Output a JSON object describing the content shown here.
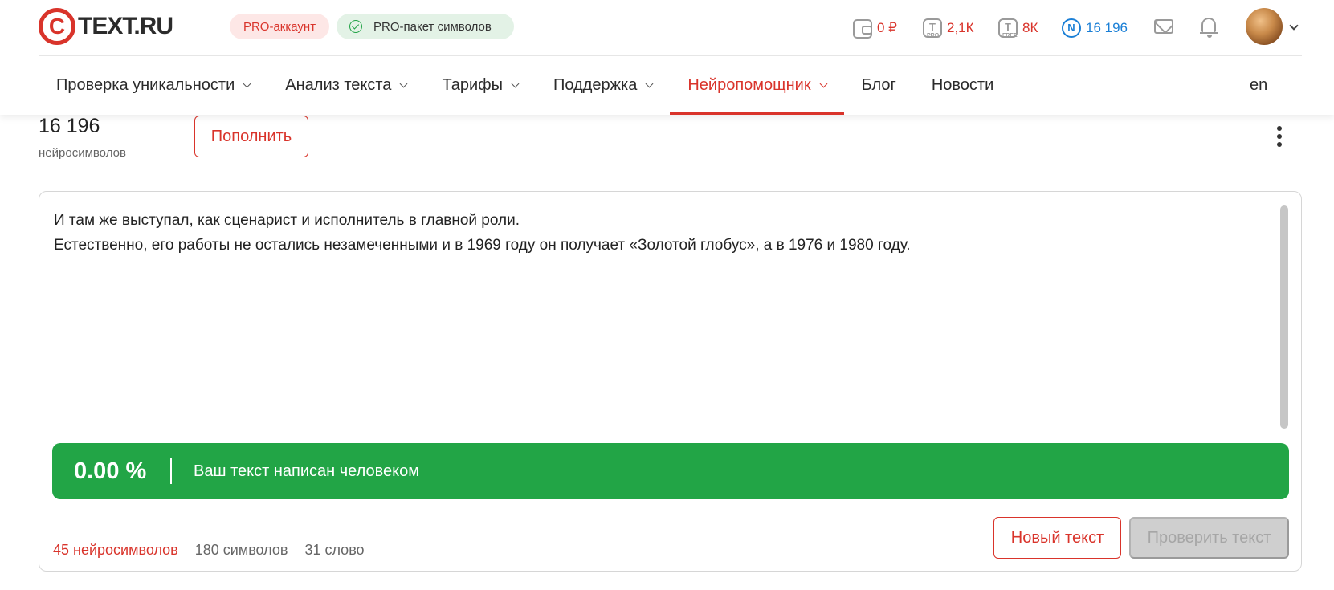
{
  "header": {
    "logo_symbol": "C",
    "logo_text": "TEXT.RU",
    "pro_account": "PRO-аккаунт",
    "pro_pack": "PRO-пакет символов",
    "stats": {
      "wallet": "0 ₽",
      "pro_symbols": "2,1К",
      "pro_label": "PRO",
      "free_symbols": "8К",
      "free_label": "FREE",
      "neuro_symbols": "16 196",
      "neuro_letter": "N"
    },
    "icons": [
      "wallet-icon",
      "pro-symbols-icon",
      "free-symbols-icon",
      "neuro-coin-icon",
      "mail-icon",
      "bell-icon",
      "avatar",
      "chevron-down-icon"
    ],
    "colors": {
      "accent": "#d9342b",
      "neuro": "#1a7fd6",
      "success": "#22a546"
    }
  },
  "nav": {
    "items": [
      {
        "label": "Проверка уникальности"
      },
      {
        "label": "Анализ текста"
      },
      {
        "label": "Тарифы"
      },
      {
        "label": "Поддержка"
      },
      {
        "label": "Нейропомощник"
      },
      {
        "label": "Блог"
      },
      {
        "label": "Новости"
      }
    ],
    "active": "Нейропомощник",
    "lang": "en"
  },
  "balance": {
    "value": "16 196",
    "label": "нейросимволов",
    "topup_label": "Пополнить"
  },
  "editor": {
    "lines": [
      "И там же выступал, как сценарист и исполнитель в главной роли.",
      "Естественно, его работы не остались незамеченными и в 1969 году он получает «Золотой глобус», а в 1976 и 1980 году."
    ],
    "result": {
      "percent": "0.00 %",
      "message": "Ваш текст написан человеком"
    },
    "counts": {
      "neuro": "45 нейросимволов",
      "chars": "180 символов",
      "words": "31 слово"
    },
    "new_text_label": "Новый текст",
    "check_label": "Проверить текст"
  }
}
